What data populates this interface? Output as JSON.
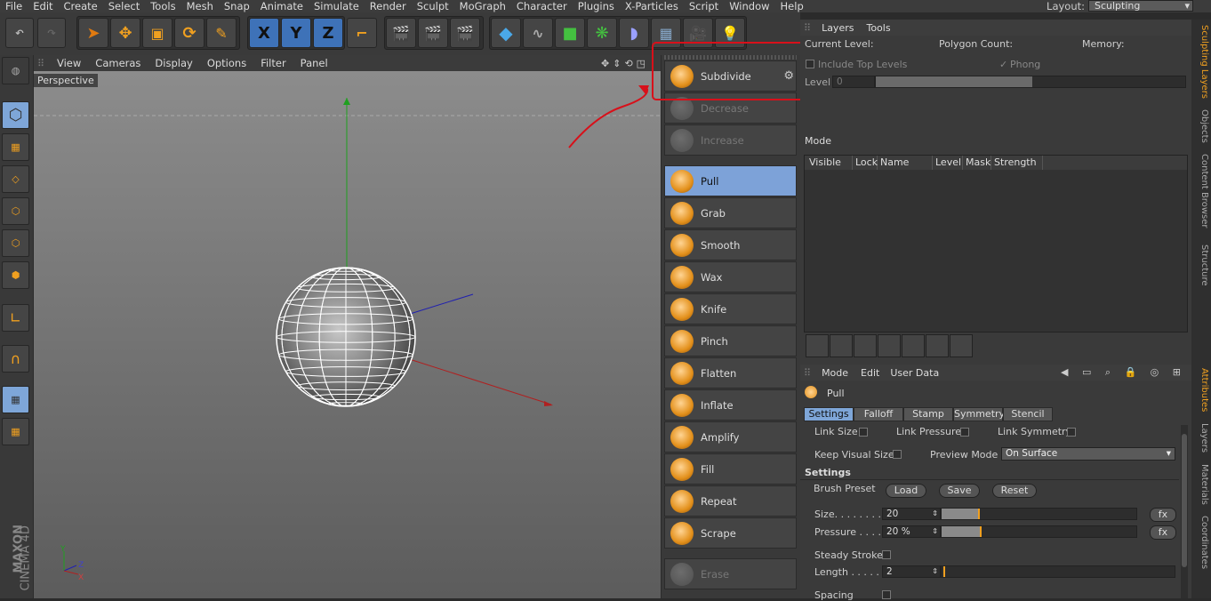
{
  "menubar": {
    "items": [
      "File",
      "Edit",
      "Create",
      "Select",
      "Tools",
      "Mesh",
      "Snap",
      "Animate",
      "Simulate",
      "Render",
      "Sculpt",
      "MoGraph",
      "Character",
      "Plugins",
      "X-Particles",
      "Script",
      "Window",
      "Help"
    ],
    "layout_label": "Layout:",
    "layout_value": "Sculpting"
  },
  "toolbar": {
    "axes": [
      "X",
      "Y",
      "Z"
    ]
  },
  "viewport": {
    "menu": [
      "View",
      "Cameras",
      "Display",
      "Options",
      "Filter",
      "Panel"
    ],
    "camera_label": "Perspective",
    "watermark_brand": "MAXON",
    "watermark_product": "CINEMA 4D",
    "axis_labels": [
      "Y",
      "Z",
      "X"
    ]
  },
  "brushes": {
    "subdivide": "Subdivide",
    "decrease": "Decrease",
    "increase": "Increase",
    "items": [
      "Pull",
      "Grab",
      "Smooth",
      "Wax",
      "Knife",
      "Pinch",
      "Flatten",
      "Inflate",
      "Amplify",
      "Fill",
      "Repeat",
      "Scrape"
    ],
    "erase": "Erase",
    "selected": "Pull"
  },
  "layers_panel": {
    "tabs": [
      "Layers",
      "Tools"
    ],
    "current_level": "Current Level:",
    "polygon_count": "Polygon Count:",
    "memory": "Memory:",
    "include_top_levels": "Include Top Levels",
    "phong": "Phong",
    "level_label": "Level",
    "level_value": "0",
    "mode_label": "Mode",
    "columns": [
      "Visible",
      "Lock",
      "Name",
      "Level",
      "Mask",
      "Strength"
    ]
  },
  "attributes": {
    "menu": [
      "Mode",
      "Edit",
      "User Data"
    ],
    "object_name": "Pull",
    "tabs": [
      "Settings",
      "Falloff",
      "Stamp",
      "Symmetry",
      "Stencil"
    ],
    "active_tab": "Settings",
    "link_size": "Link Size",
    "link_pressure": "Link Pressure",
    "link_symmetry": "Link Symmetry",
    "keep_visual_size": "Keep Visual Size",
    "preview_mode_label": "Preview Mode",
    "preview_mode_value": "On Surface",
    "settings_header": "Settings",
    "brush_preset": "Brush Preset",
    "load": "Load",
    "save": "Save",
    "reset": "Reset",
    "size_label": "Size. . . . . . . .",
    "size_value": "20",
    "pressure_label": "Pressure . . . .",
    "pressure_value": "20 %",
    "fx": "fx",
    "steady_stroke": "Steady Stroke",
    "length_label": "Length . . . . .",
    "length_value": "2",
    "spacing": "Spacing"
  },
  "right_tabs": [
    "Sculpting Layers",
    "Objects",
    "Content Browser",
    "Structure",
    "Attributes",
    "Layers",
    "Materials",
    "Coordinates"
  ],
  "colors": {
    "accent_orange": "#f0a020",
    "selection_blue": "#7da2d8",
    "annotation_red": "#d8101a"
  }
}
